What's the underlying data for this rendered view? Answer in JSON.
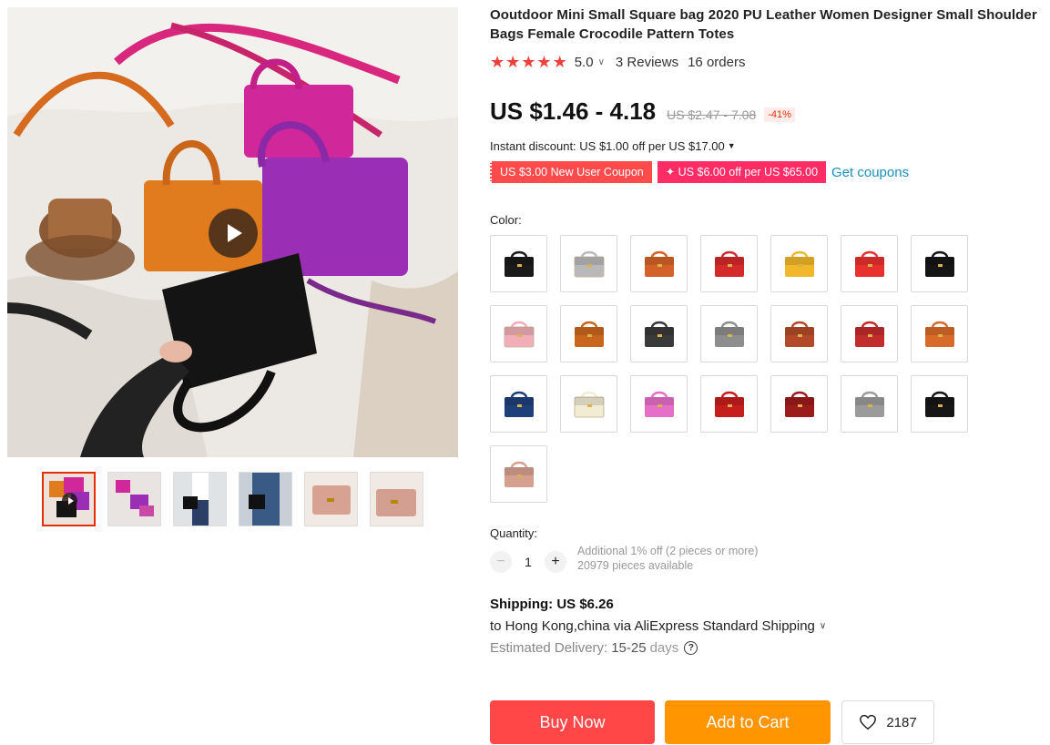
{
  "gallery": {
    "thumbnails": [
      {
        "name": "thumb-1",
        "active": true,
        "video": true
      },
      {
        "name": "thumb-2"
      },
      {
        "name": "thumb-3"
      },
      {
        "name": "thumb-4"
      },
      {
        "name": "thumb-5"
      },
      {
        "name": "thumb-6"
      }
    ]
  },
  "product": {
    "title": "Ooutdoor Mini Small Square bag 2020 PU Leather Women Designer Small Shoulder Bags Female Crocodile Pattern Totes",
    "rating": "5.0",
    "reviews": "3 Reviews",
    "orders": "16 orders",
    "price": "US $1.46 - 4.18",
    "old_price": "US $2.47 - 7.08",
    "discount": "-41%",
    "instant_discount": "Instant discount: US $1.00 off per US $17.00"
  },
  "coupons": {
    "new_user": "US $3.00 New User Coupon",
    "store": "✦ US $6.00 off per US $65.00",
    "get": "Get coupons"
  },
  "colors": {
    "label": "Color:",
    "swatch_colors": [
      "#1a1a1a",
      "#b9b9bb",
      "#d4612a",
      "#d42a2a",
      "#f0b82a",
      "#e8302e",
      "#151515",
      "#f2aeb8",
      "#c9661d",
      "#3a3a3a",
      "#8e8e8e",
      "#b24a2a",
      "#c22c2c",
      "#d86a2a",
      "#1f3f7a",
      "#f2ecd4",
      "#e66fc7",
      "#c61d1d",
      "#9c1b1b",
      "#9b9b9b",
      "#161616",
      "#d6a090"
    ]
  },
  "quantity": {
    "label": "Quantity:",
    "value": "1",
    "note1": "Additional 1% off (2 pieces or more)",
    "note2": "20979 pieces available"
  },
  "shipping": {
    "cost": "Shipping: US $6.26",
    "destination": "to Hong Kong,china via AliExpress Standard Shipping",
    "delivery_label": "Estimated Delivery:",
    "delivery_value": "15-25",
    "delivery_unit": "days"
  },
  "actions": {
    "buy": "Buy Now",
    "cart": "Add to Cart",
    "wishlist_count": "2187"
  }
}
